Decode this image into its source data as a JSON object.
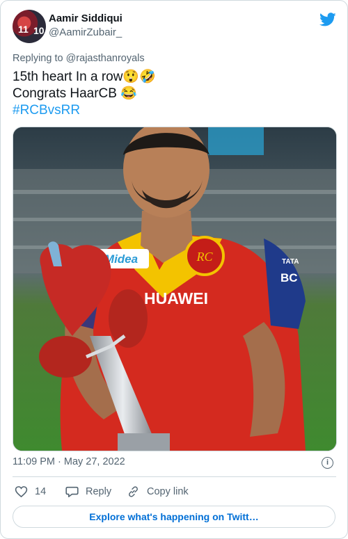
{
  "author": {
    "name": "Aamir Siddiqui",
    "handle": "@AamirZubair_",
    "avatar_text": [
      "11",
      "10"
    ]
  },
  "reply": {
    "prefix": "Replying to",
    "to": "@rajasthanroyals"
  },
  "tweet": {
    "line1": "15th heart In a row😲🤣",
    "line2": "Congrats HaarCB 😂",
    "hashtag": "#RCBvsRR"
  },
  "media": {
    "sponsor_left": "Midea",
    "sponsor_main": "HUAWEI",
    "sleeve_text": "TATA",
    "sleeve_text2": "BC",
    "badge_text": "RC"
  },
  "meta": {
    "timestamp": "11:09 PM · May 27, 2022"
  },
  "actions": {
    "like_count": "14",
    "reply_label": "Reply",
    "copy_label": "Copy link"
  },
  "explore_label": "Explore what's happening on Twitt…",
  "colors": {
    "accent": "#1d9bf0",
    "link": "#006fd6",
    "muted": "#536471",
    "border": "#cfd9de"
  }
}
